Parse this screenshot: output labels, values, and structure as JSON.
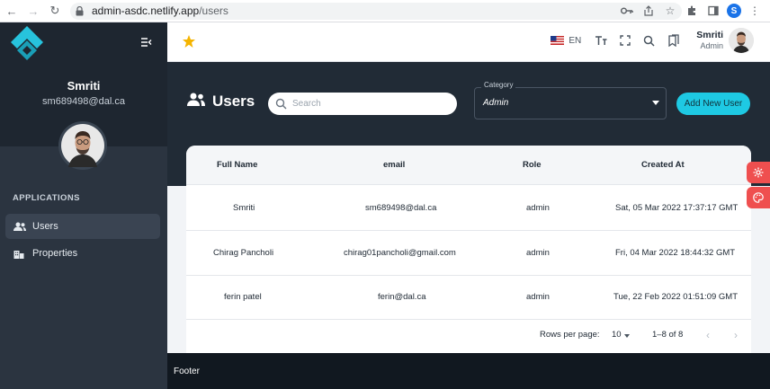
{
  "browser": {
    "url_host": "admin-asdc.netlify.app",
    "url_path": "/users",
    "profile_initial": "S"
  },
  "sidebar": {
    "user_name": "Smriti",
    "user_email": "sm689498@dal.ca",
    "section_label": "APPLICATIONS",
    "items": [
      {
        "label": "Users",
        "icon": "users-icon",
        "active": true
      },
      {
        "label": "Properties",
        "icon": "buildings-icon",
        "active": false
      }
    ]
  },
  "header": {
    "language": "EN",
    "user_name": "Smriti",
    "user_role": "Admin"
  },
  "page": {
    "title": "Users",
    "search_placeholder": "Search",
    "category_label": "Category",
    "category_value": "Admin",
    "add_button_label": "Add New User"
  },
  "table": {
    "columns": [
      "Full Name",
      "email",
      "Role",
      "Created At"
    ],
    "rows": [
      {
        "full_name": "Smriti",
        "email": "sm689498@dal.ca",
        "role": "admin",
        "created_at": "Sat, 05 Mar 2022 17:37:17 GMT"
      },
      {
        "full_name": "Chirag Pancholi",
        "email": "chirag01pancholi@gmail.com",
        "role": "admin",
        "created_at": "Fri, 04 Mar 2022 18:44:32 GMT"
      },
      {
        "full_name": "ferin patel",
        "email": "ferin@dal.ca",
        "role": "admin",
        "created_at": "Tue, 22 Feb 2022 01:51:09 GMT"
      }
    ],
    "rows_per_page_label": "Rows per page:",
    "rows_per_page_value": "10",
    "range_text": "1–8 of 8"
  },
  "footer": {
    "text": "Footer"
  },
  "colors": {
    "accent": "#1ec9e3",
    "banner": "#212b36",
    "sidebar": "#2b3440",
    "side_buttons": "#ef4f4f",
    "star": "#f5b400"
  }
}
